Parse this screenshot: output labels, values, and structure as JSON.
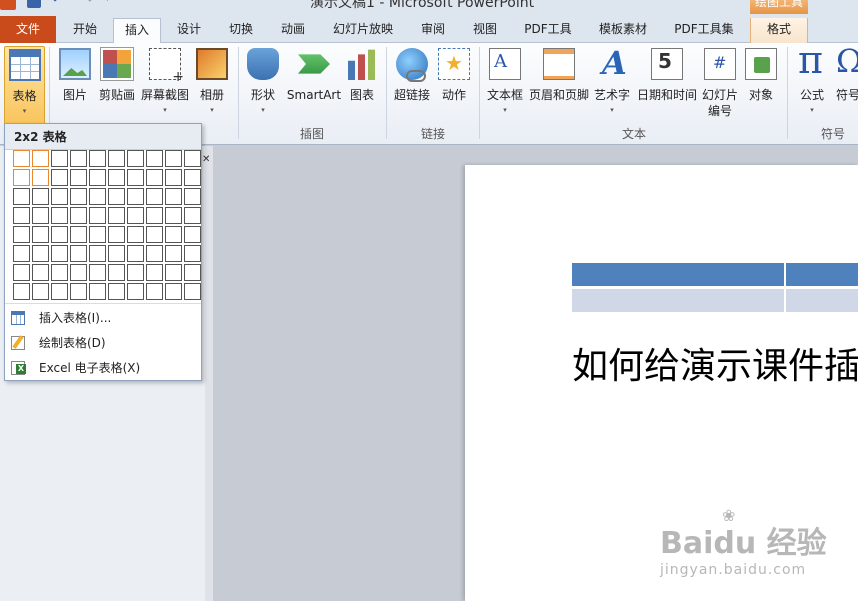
{
  "window": {
    "title": "演示文稿1 - Microsoft PowerPoint",
    "context_group": "绘图工具"
  },
  "tabs": [
    "文件",
    "开始",
    "插入",
    "设计",
    "切换",
    "动画",
    "幻灯片放映",
    "审阅",
    "视图",
    "PDF工具",
    "模板素材",
    "PDF工具集",
    "格式"
  ],
  "active_tab": "插入",
  "ribbon": {
    "buttons": {
      "table": "表格",
      "picture": "图片",
      "clipart": "剪贴画",
      "screenshot": "屏幕截图",
      "album": "相册",
      "shapes": "形状",
      "smartart": "SmartArt",
      "chart": "图表",
      "hyperlink": "超链接",
      "action": "动作",
      "textbox": "文本框",
      "header_footer": "页眉和页脚",
      "wordart": "艺术字",
      "datetime": "日期和时间",
      "slide_number_1": "幻灯片",
      "slide_number_2": "编号",
      "object": "对象",
      "equation": "公式",
      "symbol": "符号"
    },
    "groups": {
      "illustrations": "插图",
      "links": "链接",
      "text": "文本",
      "symbols": "符号"
    }
  },
  "table_dropdown": {
    "heading": "2x2 表格",
    "grid": {
      "rows": 8,
      "cols": 10,
      "selected_rows": 2,
      "selected_cols": 2
    },
    "items": [
      "插入表格(I)...",
      "绘制表格(D)",
      "Excel 电子表格(X)"
    ]
  },
  "slide": {
    "text": "如何给演示课件插"
  },
  "watermark": {
    "logo": "Baidu 经验",
    "url": "jingyan.baidu.com"
  },
  "colors": {
    "file_tab": "#c94b1b",
    "table_header": "#4f81bd",
    "table_body": "#d0d8e8",
    "grid_selected": "#e8872d"
  }
}
